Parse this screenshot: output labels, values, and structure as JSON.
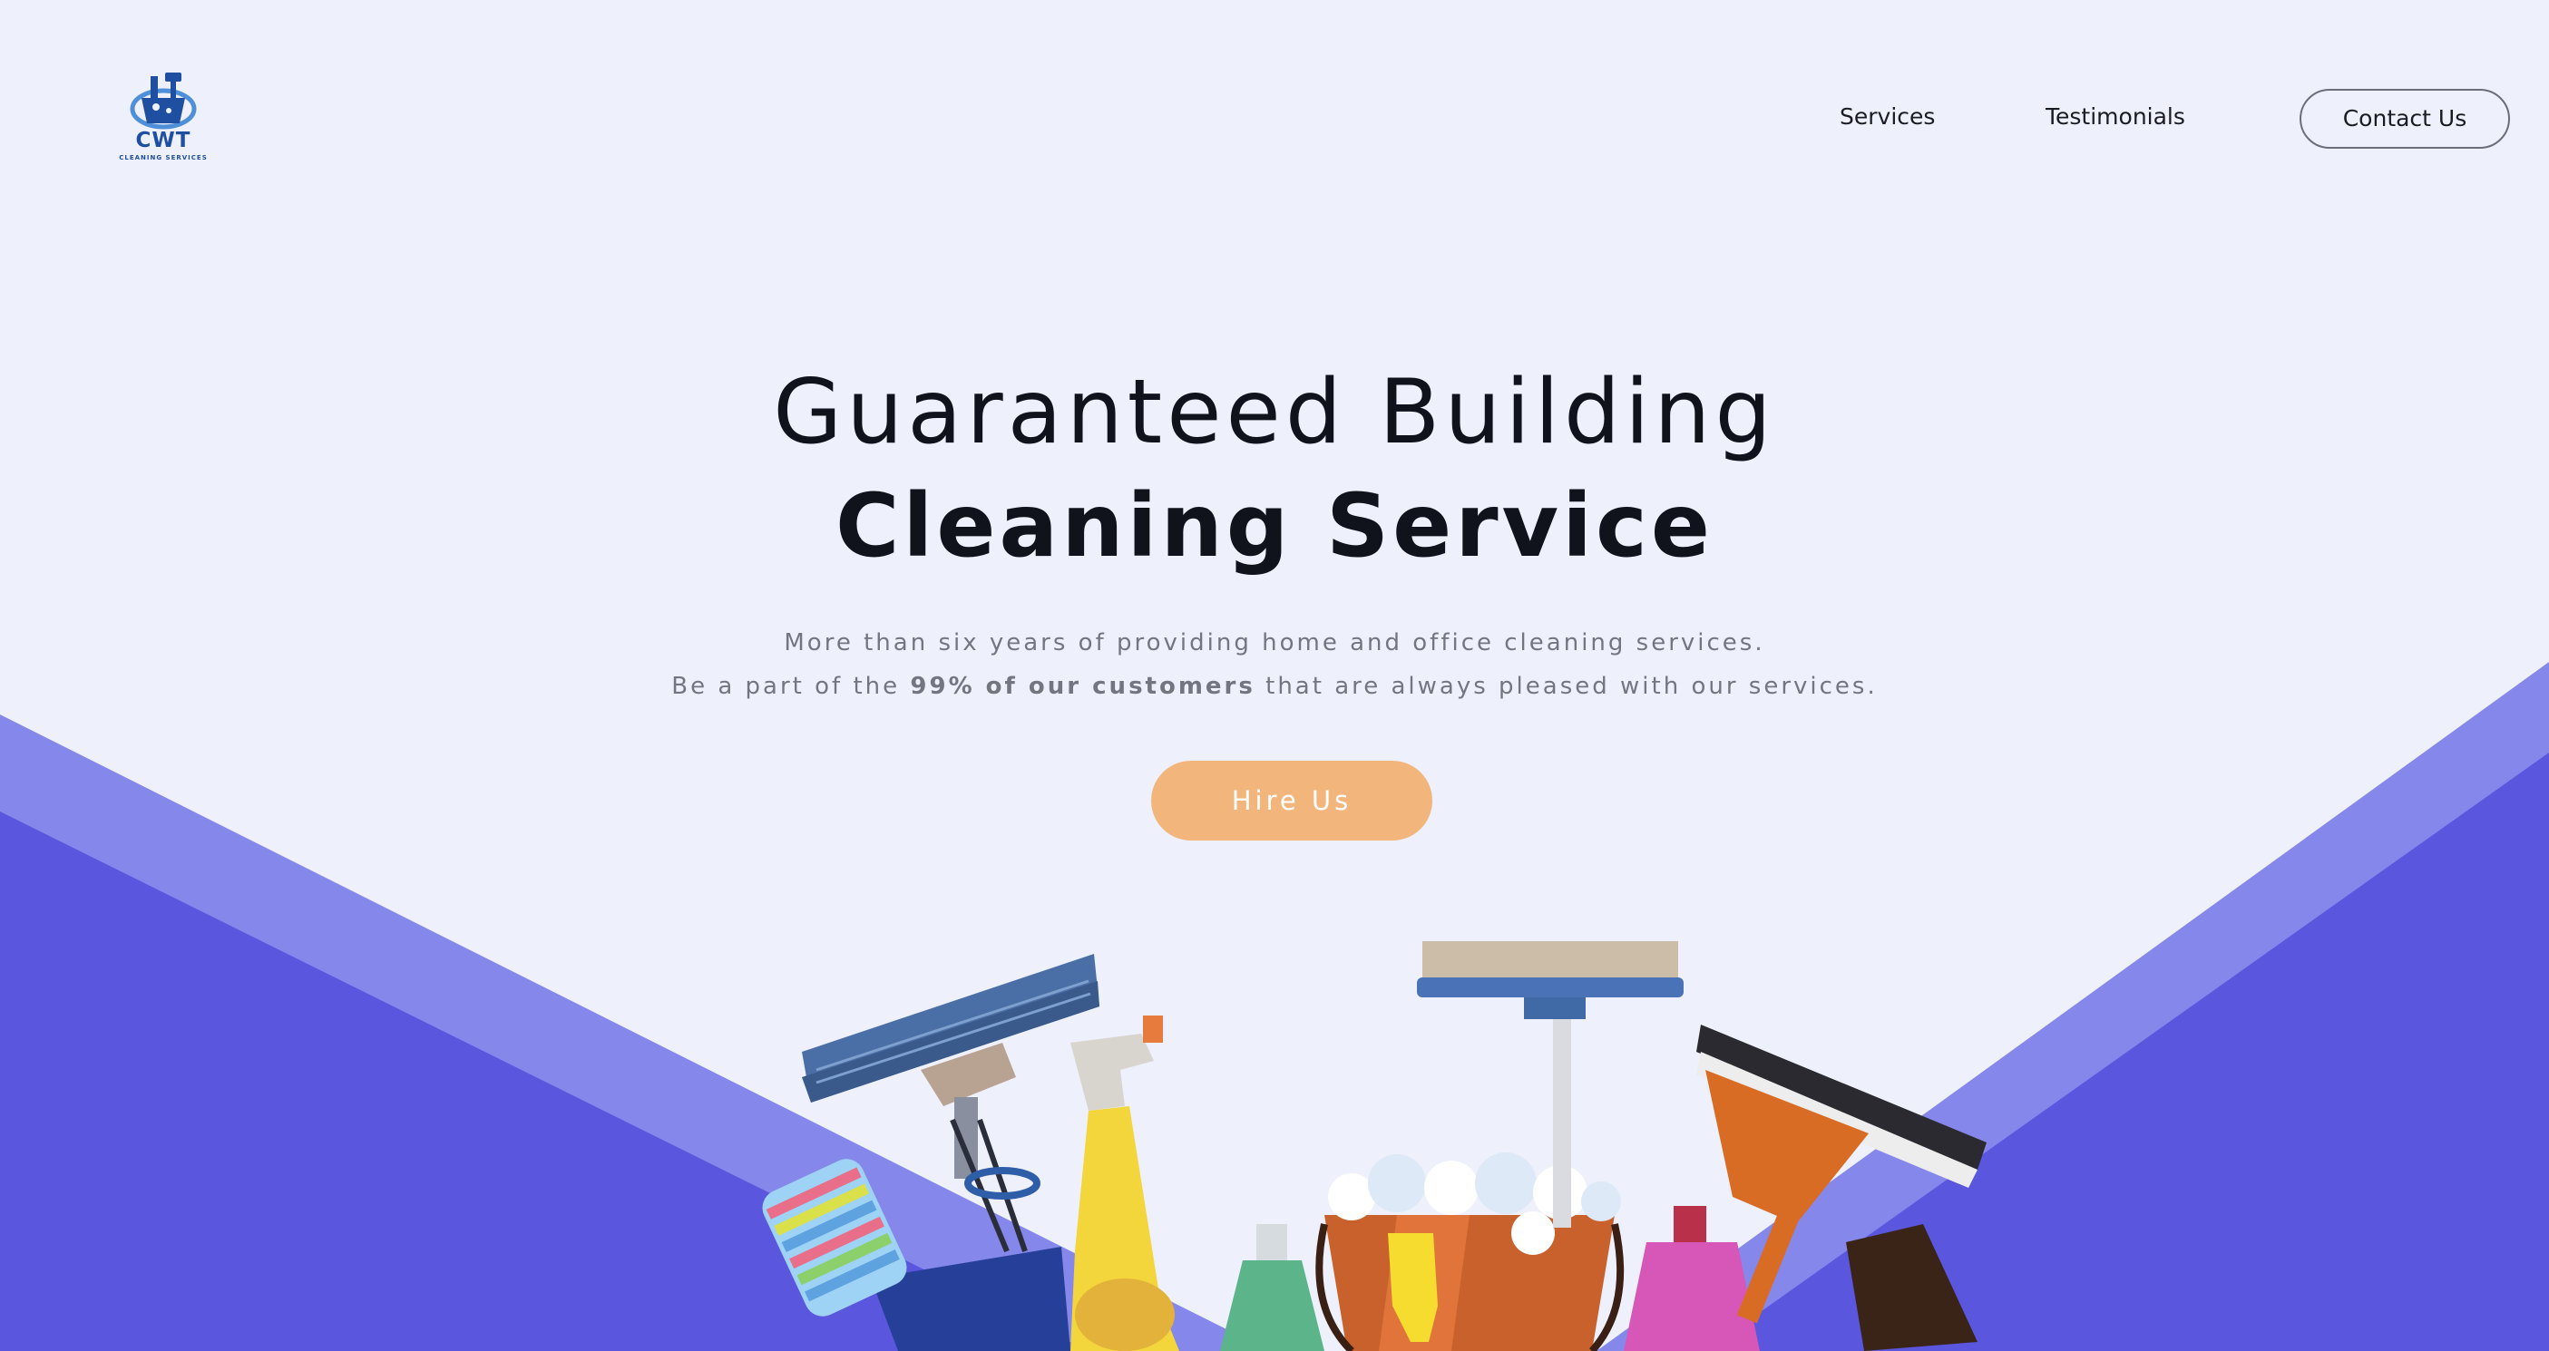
{
  "header": {
    "logo": {
      "title": "CWT",
      "subtitle": "CLEANING SERVICES"
    },
    "nav": [
      {
        "label": "Services"
      },
      {
        "label": "Testimonials"
      }
    ],
    "contact_label": "Contact Us"
  },
  "hero": {
    "title_line1": "Guaranteed Building",
    "title_line2": "Cleaning Service",
    "subtitle_line1": "More than six years of providing home and office cleaning services.",
    "subtitle_line2_before": "Be a part of the ",
    "subtitle_line2_bold": "99% of our customers",
    "subtitle_line2_after": " that are always pleased with our services.",
    "cta_label": "Hire Us"
  },
  "colors": {
    "background": "#eef0fb",
    "wedge_light": "#8587ea",
    "wedge_dark": "#5a56de",
    "cta": "#f2b57c",
    "logo": "#1f4fa0",
    "text_dark": "#10121c",
    "text_muted": "#74767f"
  },
  "icons": {
    "logo_mark": "cleaning-bucket-logo-icon",
    "illustration": "cleaning-supplies-illustration"
  }
}
